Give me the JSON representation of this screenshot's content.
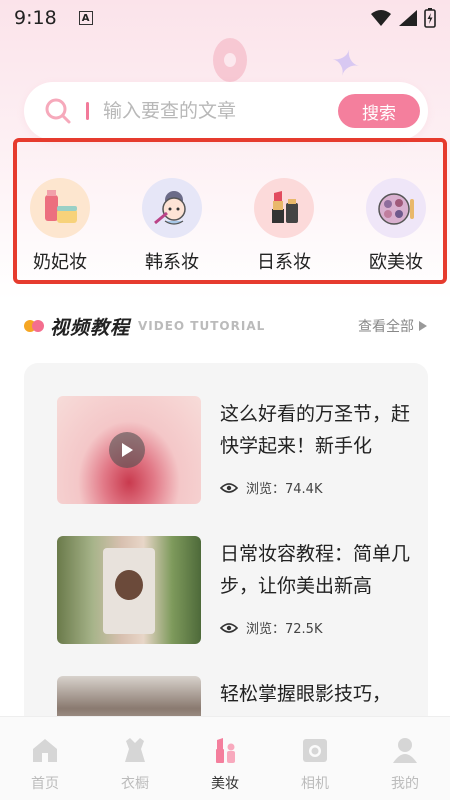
{
  "status_bar": {
    "time": "9:18",
    "notif_icon": "A"
  },
  "search": {
    "placeholder": "输入要查的文章",
    "button_label": "搜索"
  },
  "categories": [
    {
      "label": "奶妃妆",
      "icon": "cosmetics-bottles-icon",
      "bg": "#fde6cf"
    },
    {
      "label": "韩系妆",
      "icon": "girl-makeup-icon",
      "bg": "#e6e6f7"
    },
    {
      "label": "日系妆",
      "icon": "lipstick-icon",
      "bg": "#fcdada"
    },
    {
      "label": "欧美妆",
      "icon": "eyeshadow-palette-icon",
      "bg": "#efe6f8"
    }
  ],
  "section": {
    "title": "视频教程",
    "subtitle": "VIDEO TUTORIAL",
    "more_label": "查看全部"
  },
  "videos": [
    {
      "title": "这么好看的万圣节，赶快学起来！新手化",
      "views_label": "浏览：74.4K"
    },
    {
      "title": "日常妆容教程：简单几步，让你美出新高",
      "views_label": "浏览：72.5K"
    },
    {
      "title": "轻松掌握眼影技巧，",
      "views_label": ""
    }
  ],
  "tabbar": [
    {
      "label": "首页",
      "icon": "home-icon",
      "active": false
    },
    {
      "label": "衣橱",
      "icon": "wardrobe-icon",
      "active": false
    },
    {
      "label": "美妆",
      "icon": "makeup-icon",
      "active": true
    },
    {
      "label": "相机",
      "icon": "camera-icon",
      "active": false
    },
    {
      "label": "我的",
      "icon": "profile-icon",
      "active": false
    }
  ],
  "colors": {
    "accent": "#f47f9d",
    "highlight_border": "#e63b2e"
  }
}
